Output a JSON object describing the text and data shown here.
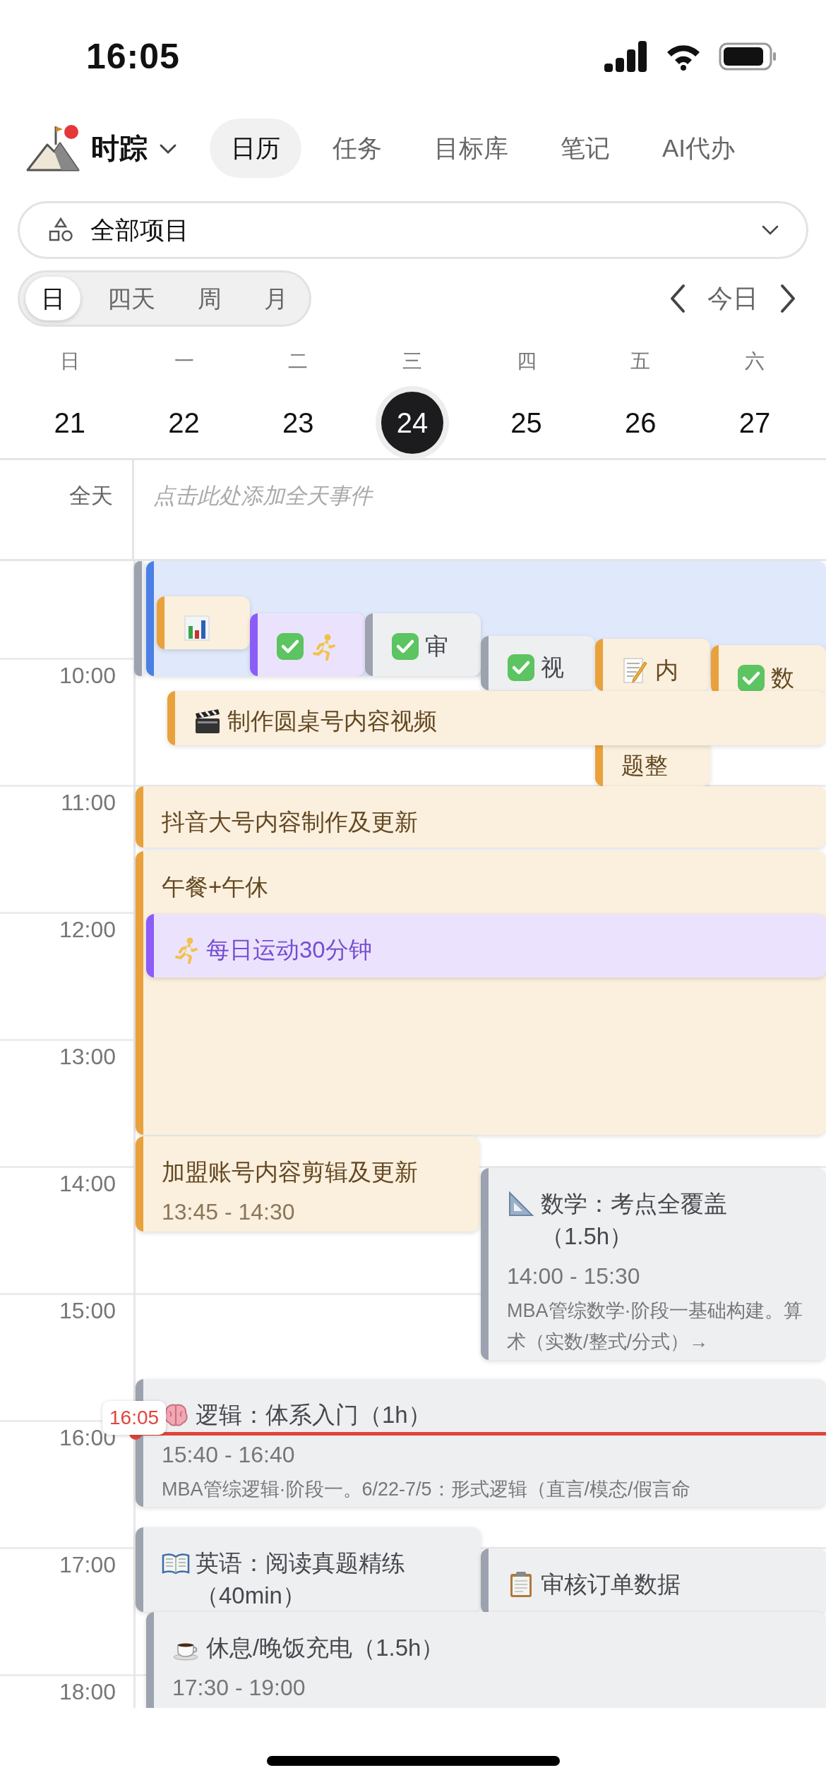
{
  "status_bar": {
    "time": "16:05"
  },
  "app": {
    "name": "时踪",
    "notification": true
  },
  "tabs": [
    {
      "label": "日历",
      "selected": true
    },
    {
      "label": "任务",
      "selected": false
    },
    {
      "label": "目标库",
      "selected": false
    },
    {
      "label": "笔记",
      "selected": false
    },
    {
      "label": "AI代办",
      "selected": false
    }
  ],
  "project_filter": {
    "value": "全部项目"
  },
  "view_modes": [
    {
      "label": "日",
      "selected": true
    },
    {
      "label": "四天",
      "selected": false
    },
    {
      "label": "周",
      "selected": false
    },
    {
      "label": "月",
      "selected": false
    }
  ],
  "today_button": "今日",
  "week": [
    {
      "weekday": "日",
      "date": "21",
      "selected": false
    },
    {
      "weekday": "一",
      "date": "22",
      "selected": false
    },
    {
      "weekday": "二",
      "date": "23",
      "selected": false
    },
    {
      "weekday": "三",
      "date": "24",
      "selected": true
    },
    {
      "weekday": "四",
      "date": "25",
      "selected": false
    },
    {
      "weekday": "五",
      "date": "26",
      "selected": false
    },
    {
      "weekday": "六",
      "date": "27",
      "selected": false
    }
  ],
  "all_day": {
    "label": "全天",
    "placeholder": "点击此处添加全天事件"
  },
  "hour_labels": [
    "10:00",
    "11:00",
    "12:00",
    "13:00",
    "14:00",
    "15:00",
    "16:00",
    "17:00",
    "18:00"
  ],
  "now": {
    "time": "16:05"
  },
  "events": [
    {
      "color": "#9ca3af",
      "kind": "event",
      "done": false
    },
    {
      "color": "#4a7fe6",
      "kind": "event",
      "done": false
    },
    {
      "color": "#e9a13b",
      "kind": "event",
      "done": false
    },
    {
      "color": "#8b5cf6",
      "kind": "habit",
      "done": true
    },
    {
      "title": "审",
      "color": "#9ca3af",
      "kind": "event",
      "done": true
    },
    {
      "title": "视",
      "color": "#9ca3af",
      "kind": "event",
      "done": true
    },
    {
      "title": "内",
      "title_tail": "题整",
      "color": "#e9a13b",
      "kind": "event",
      "done": false
    },
    {
      "title": "数",
      "color": "#e9a13b",
      "kind": "event",
      "done": true
    },
    {
      "title": "制作圆桌号内容视频",
      "color": "#e9a13b",
      "kind": "event",
      "done": false
    },
    {
      "title": "抖音大号内容制作及更新",
      "color": "#e9a13b",
      "kind": "event",
      "done": false
    },
    {
      "title": "午餐+午休",
      "color": "#e9a13b",
      "kind": "event",
      "done": false
    },
    {
      "title": "每日运动30分钟",
      "color": "#8b5cf6",
      "kind": "habit",
      "done": false
    },
    {
      "title": "加盟账号内容剪辑及更新",
      "time": "13:45 - 14:30",
      "color": "#e9a13b",
      "kind": "event",
      "done": false
    },
    {
      "title": "数学：考点全覆盖（1.5h）",
      "time": "14:00 - 15:30",
      "description": "MBA管综数学·阶段一基础构建。算术（实数/整式/分式）→",
      "color": "#9ca3af",
      "kind": "event",
      "done": false
    },
    {
      "title": "逻辑：体系入门（1h）",
      "time": "15:40 - 16:40",
      "description": "MBA管综逻辑·阶段一。6/22-7/5：形式逻辑（直言/模态/假言命",
      "color": "#9ca3af",
      "kind": "event",
      "done": false
    },
    {
      "title": "英语：阅读真题精练（40min）",
      "color": "#9ca3af",
      "kind": "event",
      "done": false
    },
    {
      "title": "审核订单数据",
      "color": "#9ca3af",
      "kind": "event",
      "done": false
    },
    {
      "title": "休息/晚饭充电（1.5h）",
      "time": "17:30 - 19:00",
      "color": "#9ca3af",
      "kind": "event",
      "done": false
    }
  ]
}
